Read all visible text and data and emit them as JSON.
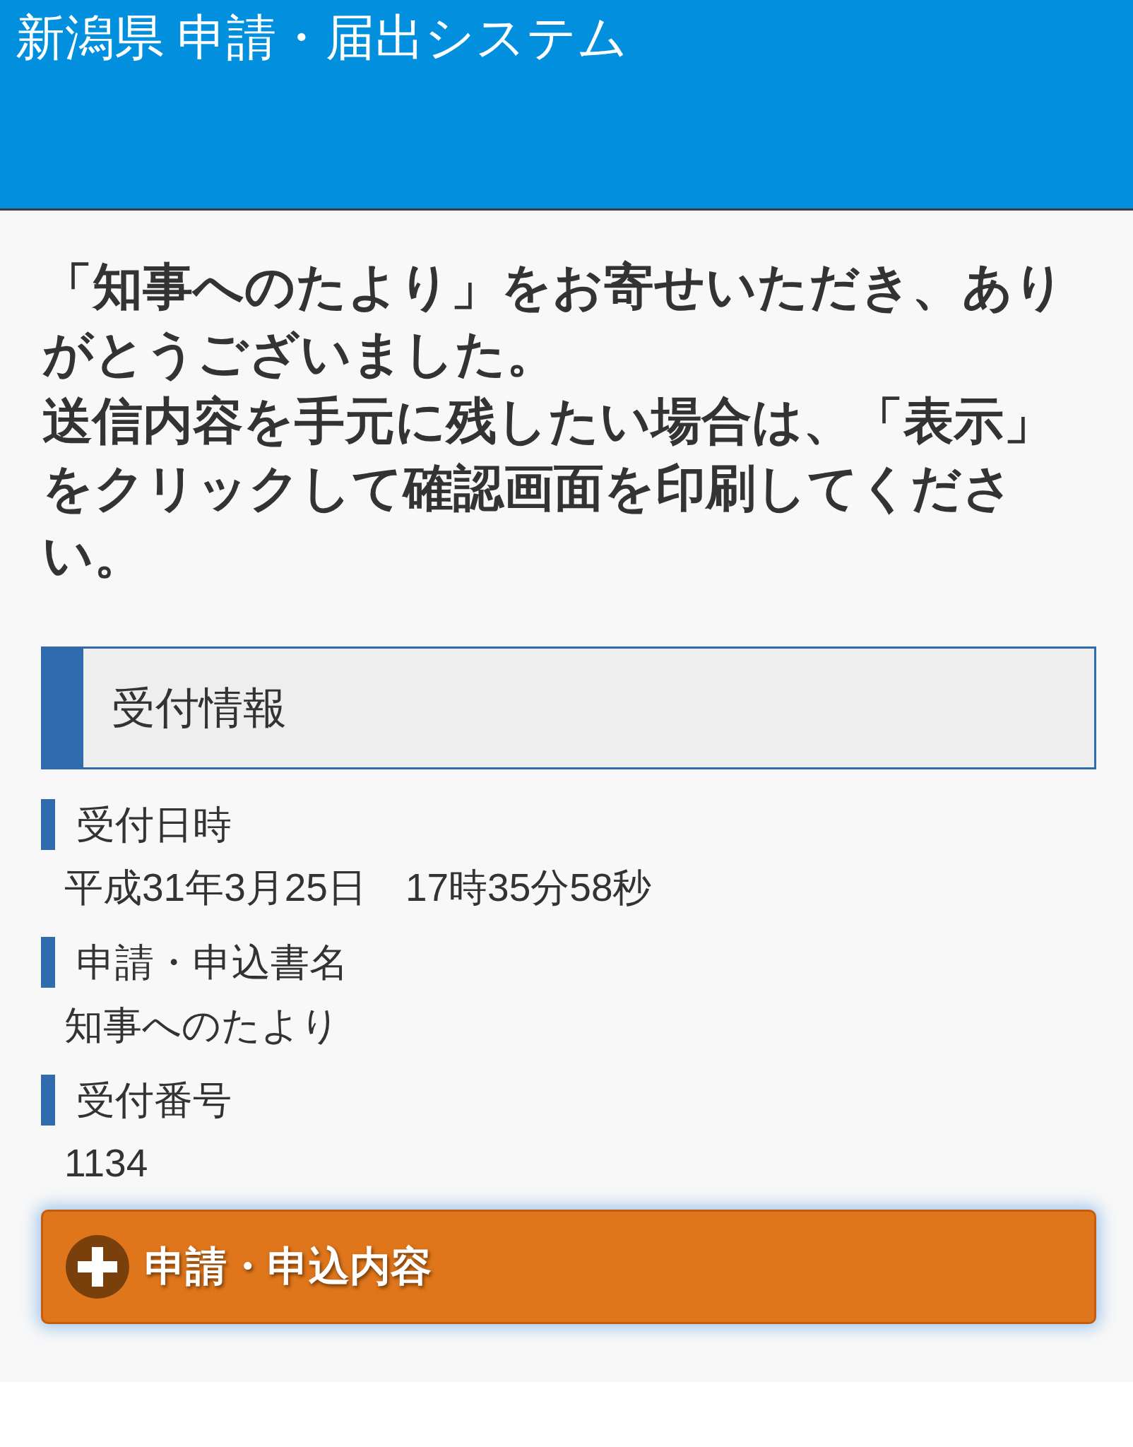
{
  "header": {
    "title": "新潟県 申請・届出システム"
  },
  "message": {
    "paragraphs": [
      "「知事へのたより」をお寄せいただき、ありがとうございました。",
      "送信内容を手元に残したい場合は、「表示」をクリックして確認画面を印刷してください。"
    ]
  },
  "section": {
    "title": "受付情報"
  },
  "fields": [
    {
      "label": "受付日時",
      "value": "平成31年3月25日　17時35分58秒"
    },
    {
      "label": "申請・申込書名",
      "value": "知事へのたより"
    },
    {
      "label": "受付番号",
      "value": "1134"
    }
  ],
  "accordion": {
    "label": "申請・申込内容",
    "expanded": false
  }
}
